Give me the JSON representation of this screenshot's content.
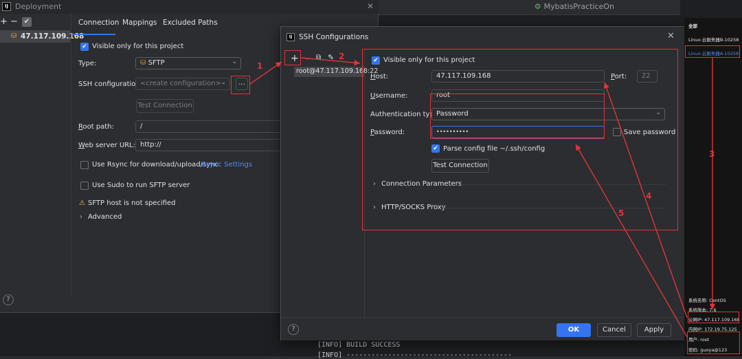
{
  "ide": {
    "project_name": "MybatisPracticeOn",
    "console_lines": [
      "[INFO] BUILD SUCCESS",
      "[INFO] ----------------------------------------"
    ]
  },
  "deployment": {
    "title": "Deployment",
    "logo_text": "IJ",
    "toolbar": {
      "add": "+",
      "remove": "−",
      "confirm": "✔"
    },
    "server_name": "47.117.109.168",
    "tabs": [
      "Connection",
      "Mappings",
      "Excluded Paths"
    ],
    "visible_only_label": "Visible only for this project",
    "type_label": "Type:",
    "type_value": "SFTP",
    "ssh_config_label": "SSH configuration:",
    "ssh_config_placeholder": "<create configuration>",
    "browse_button": "...",
    "test_connection": "Test Connection",
    "root_path_label": "Root path:",
    "root_path_value": "/",
    "web_server_label": "Web server URL:",
    "web_server_value": "http://",
    "rsync_label": "Use Rsync for download/upload/sync",
    "rsync_settings": "Rsync Settings",
    "sudo_label": "Use Sudo to run SFTP server",
    "warning_text": "SFTP host is not specified",
    "advanced_label": "Advanced",
    "help": "?"
  },
  "ssh_dialog": {
    "title": "SSH Configurations",
    "logo_text": "IJ",
    "toolbar": {
      "add": "+",
      "remove": "−",
      "copy": "⧉",
      "edit": "✎"
    },
    "list_item": "root@47.117.109.168:22",
    "visible_only_label": "Visible only for this project",
    "host_label": "Host:",
    "host_value": "47.117.109.168",
    "port_label": "Port:",
    "port_value": "22",
    "username_label": "Username:",
    "username_value": "root",
    "auth_label": "Authentication type:",
    "auth_value": "Password",
    "password_label": "Password:",
    "password_value": "••••••••••",
    "save_password_label": "Save password",
    "parse_config_label": "Parse config file ~/.ssh/config",
    "test_connection": "Test Connection",
    "connection_params": "Connection Parameters",
    "proxy": "HTTP/SOCKS Proxy",
    "ok": "OK",
    "cancel": "Cancel",
    "apply": "Apply",
    "help": "?"
  },
  "server_card": {
    "header": "全部",
    "items": [
      "Linux-云服务器B-10258",
      "Linux-云服务器A-10258"
    ],
    "os_name": "系统名称: CentOS",
    "os_version": "系统版本: 7.6",
    "public_ip": "公网IP: 47.117.109.168",
    "private_ip": "内网IP: 172.19.75.125",
    "user": "用户: root",
    "password": "密码: guoya@123"
  },
  "annotations": [
    "1",
    "2",
    "3",
    "4",
    "5"
  ],
  "colors": {
    "accent": "#3574f0",
    "annotation": "#e0353b",
    "background": "#2b2d30"
  }
}
